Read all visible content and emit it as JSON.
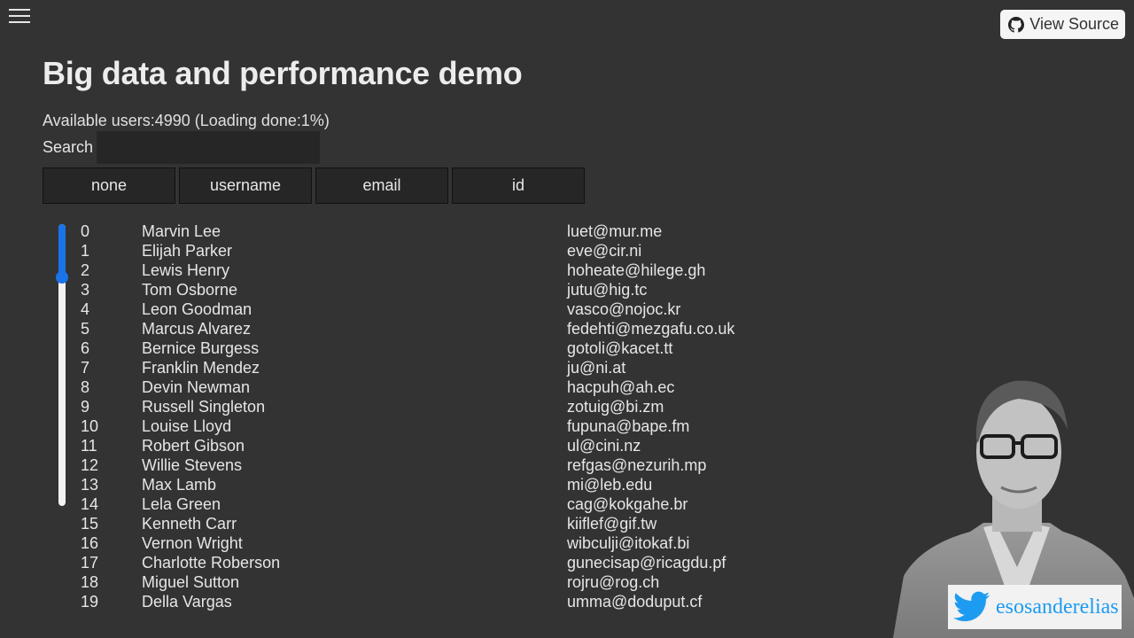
{
  "header": {
    "view_source_label": "View Source"
  },
  "main": {
    "title": "Big data and performance demo",
    "status": "Available users:4990 (Loading done:1%)",
    "search_label": "Search",
    "search_value": "",
    "sort_buttons": [
      "none",
      "username",
      "email",
      "id"
    ]
  },
  "slider": {
    "value_fraction": 0.19
  },
  "users": [
    {
      "id": "0",
      "name": "Marvin Lee",
      "email": "luet@mur.me"
    },
    {
      "id": "1",
      "name": "Elijah Parker",
      "email": "eve@cir.ni"
    },
    {
      "id": "2",
      "name": "Lewis Henry",
      "email": "hoheate@hilege.gh"
    },
    {
      "id": "3",
      "name": "Tom Osborne",
      "email": "jutu@hig.tc"
    },
    {
      "id": "4",
      "name": "Leon Goodman",
      "email": "vasco@nojoc.kr"
    },
    {
      "id": "5",
      "name": "Marcus Alvarez",
      "email": "fedehti@mezgafu.co.uk"
    },
    {
      "id": "6",
      "name": "Bernice Burgess",
      "email": "gotoli@kacet.tt"
    },
    {
      "id": "7",
      "name": "Franklin Mendez",
      "email": "ju@ni.at"
    },
    {
      "id": "8",
      "name": "Devin Newman",
      "email": "hacpuh@ah.ec"
    },
    {
      "id": "9",
      "name": "Russell Singleton",
      "email": "zotuig@bi.zm"
    },
    {
      "id": "10",
      "name": "Louise Lloyd",
      "email": "fupuna@bape.fm"
    },
    {
      "id": "11",
      "name": "Robert Gibson",
      "email": "ul@cini.nz"
    },
    {
      "id": "12",
      "name": "Willie Stevens",
      "email": "refgas@nezurih.mp"
    },
    {
      "id": "13",
      "name": "Max Lamb",
      "email": "mi@leb.edu"
    },
    {
      "id": "14",
      "name": "Lela Green",
      "email": "cag@kokgahe.br"
    },
    {
      "id": "15",
      "name": "Kenneth Carr",
      "email": "kiiflef@gif.tw"
    },
    {
      "id": "16",
      "name": "Vernon Wright",
      "email": "wibculji@itokaf.bi"
    },
    {
      "id": "17",
      "name": "Charlotte Roberson",
      "email": "gunecisap@ricagdu.pf"
    },
    {
      "id": "18",
      "name": "Miguel Sutton",
      "email": "rojru@rog.ch"
    },
    {
      "id": "19",
      "name": "Della Vargas",
      "email": "umma@doduput.cf"
    }
  ],
  "twitter": {
    "handle": "esosanderelias"
  },
  "colors": {
    "background": "#333333",
    "accent": "#1a73e8",
    "twitter_blue": "#1d9bf0"
  },
  "icons": {
    "menu": "hamburger-icon",
    "github": "github-icon",
    "twitter": "twitter-bird-icon"
  }
}
